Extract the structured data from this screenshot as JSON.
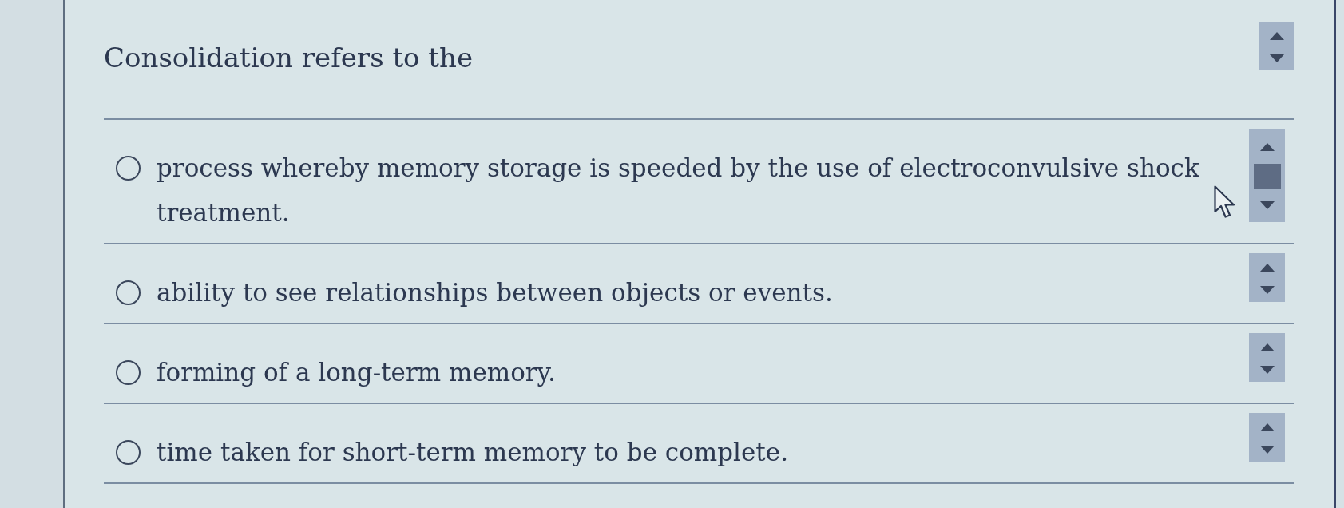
{
  "question": {
    "text": "Consolidation refers to the"
  },
  "options": [
    {
      "text": "process whereby memory storage is speeded by the use of electroconvulsive shock treatment.",
      "selected": false,
      "scroll_thumb": true
    },
    {
      "text": "ability to see relationships between objects or events.",
      "selected": false,
      "scroll_thumb": false
    },
    {
      "text": "forming of a long-term memory.",
      "selected": false,
      "scroll_thumb": false
    },
    {
      "text": "time taken for short-term memory to be complete.",
      "selected": false,
      "scroll_thumb": false
    }
  ]
}
